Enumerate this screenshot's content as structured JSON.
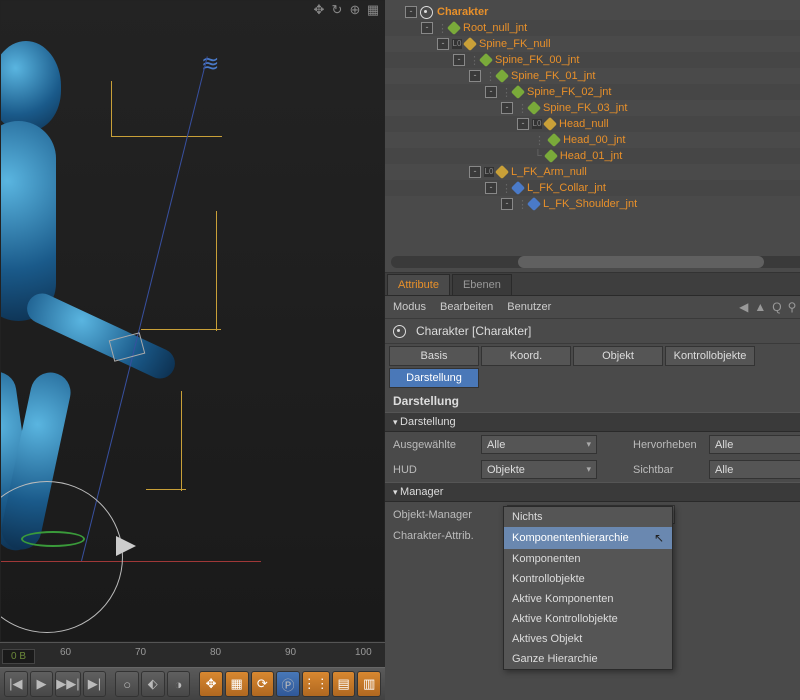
{
  "viewport": {
    "icons": [
      "✥",
      "↻",
      "⊕",
      "▦"
    ]
  },
  "hierarchy": {
    "root": "Charakter",
    "items": [
      {
        "indent": 20,
        "pre": "exp",
        "icon": "cicon",
        "name": "Charakter",
        "top": true
      },
      {
        "indent": 36,
        "pre": "exp-dots",
        "icon": "jg",
        "name": "Root_null_jnt"
      },
      {
        "indent": 52,
        "pre": "exp-l0",
        "icon": "jy",
        "name": "Spine_FK_null"
      },
      {
        "indent": 68,
        "pre": "exp-dots",
        "icon": "jg",
        "name": "Spine_FK_00_jnt"
      },
      {
        "indent": 84,
        "pre": "exp-dots",
        "icon": "jg",
        "name": "Spine_FK_01_jnt"
      },
      {
        "indent": 100,
        "pre": "exp-dots",
        "icon": "jg",
        "name": "Spine_FK_02_jnt"
      },
      {
        "indent": 116,
        "pre": "exp-dots",
        "icon": "jg",
        "name": "Spine_FK_03_jnt"
      },
      {
        "indent": 132,
        "pre": "exp-l0",
        "icon": "jy",
        "name": "Head_null"
      },
      {
        "indent": 148,
        "pre": "dots",
        "icon": "jg",
        "name": "Head_00_jnt"
      },
      {
        "indent": 148,
        "pre": "dash",
        "icon": "jg",
        "name": "Head_01_jnt"
      },
      {
        "indent": 84,
        "pre": "exp-l0",
        "icon": "jy",
        "name": "L_FK_Arm_null"
      },
      {
        "indent": 100,
        "pre": "exp-dots",
        "icon": "jb",
        "name": "L_FK_Collar_jnt"
      },
      {
        "indent": 116,
        "pre": "exp-dots",
        "icon": "jb",
        "name": "L_FK_Shoulder_jnt"
      }
    ]
  },
  "tabs": {
    "attribute": "Attribute",
    "ebenen": "Ebenen"
  },
  "menus": {
    "modus": "Modus",
    "bearbeiten": "Bearbeiten",
    "benutzer": "Benutzer"
  },
  "objheader": "Charakter [Charakter]",
  "subtabs": {
    "basis": "Basis",
    "koord": "Koord.",
    "objekt": "Objekt",
    "kontroll": "Kontrollobjekte",
    "darstellung": "Darstellung"
  },
  "section": "Darstellung",
  "groups": {
    "darstellung": "Darstellung",
    "manager": "Manager"
  },
  "props": {
    "ausgewaehlte": "Ausgewählte",
    "ausgewaehlte_val": "Alle",
    "hud": "HUD",
    "hud_val": "Objekte",
    "hervorheben": "Hervorheben",
    "hervorheben_val": "Alle",
    "sichtbar": "Sichtbar",
    "sichtbar_val": "Alle",
    "objmanager": "Objekt-Manager",
    "objmanager_val": "Komponentenhierarchie",
    "charattr": "Charakter-Attrib."
  },
  "dropdown": {
    "items": [
      "Nichts",
      "Komponentenhierarchie",
      "Komponenten",
      "Kontrollobjekte",
      "Aktive Komponenten",
      "Aktive Kontrollobjekte",
      "Aktives Objekt",
      "Ganze Hierarchie"
    ],
    "selected": "Komponentenhierarchie"
  },
  "timeline": {
    "ticks": [
      60,
      70,
      80,
      90,
      100
    ],
    "frame": "0 B"
  },
  "toolbar": [
    "|◀",
    "▶",
    "▶▶|",
    "▶|",
    "○",
    "⬖",
    "◑",
    "✥",
    "▦",
    "⟳",
    "Ⓟ",
    "⋮⋮",
    "▤",
    "▥"
  ]
}
